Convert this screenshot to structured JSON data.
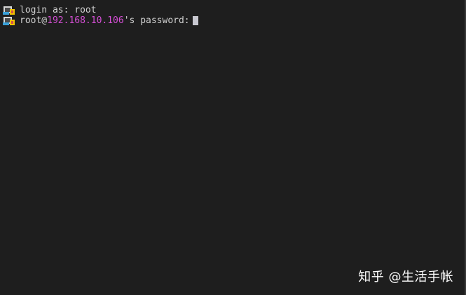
{
  "terminal": {
    "lines": [
      {
        "text": "login as: root"
      },
      {
        "user_prefix": "root@",
        "host": "192.168.10.106",
        "suffix": "'s password:"
      }
    ],
    "cursor": "block-cursor",
    "icons": [
      "terminal-key-icon",
      "terminal-key-icon"
    ],
    "colors": {
      "background": "#1e1e1e",
      "text": "#d0d0d0",
      "host": "#d64fd6",
      "cursor": "#c8c8d0"
    }
  },
  "watermark": {
    "text": "知乎 @生活手帐"
  }
}
